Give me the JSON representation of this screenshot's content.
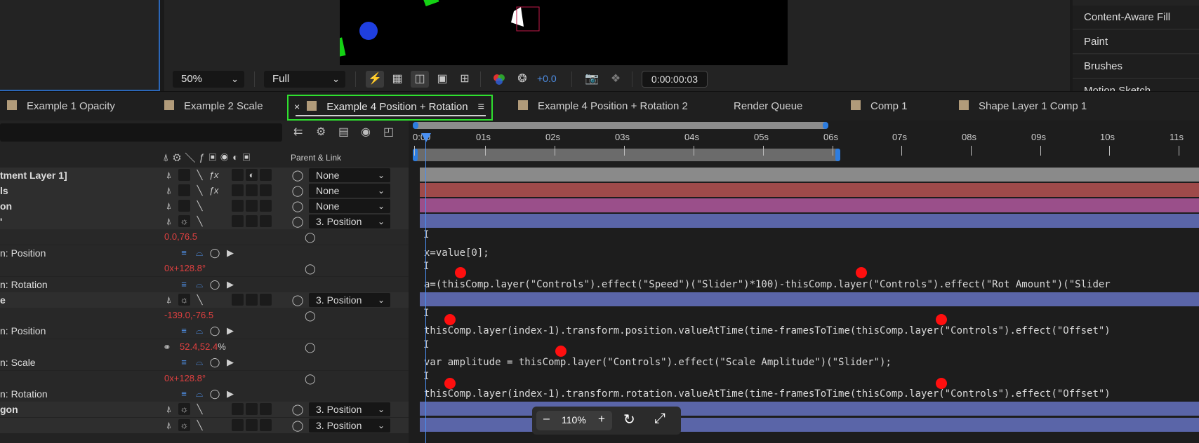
{
  "viewer": {
    "zoom": "50%",
    "resolution": "Full",
    "exposure": "+0.0",
    "timecode": "0:00:00:03"
  },
  "right_panel": {
    "items": [
      "Content-Aware Fill",
      "Paint",
      "Brushes",
      "Motion Sketch"
    ]
  },
  "tabs": [
    {
      "label": "Example 1 Opacity"
    },
    {
      "label": "Example 2 Scale"
    },
    {
      "label": "Example 4 Position + Rotation",
      "active": true
    },
    {
      "label": "Example 4 Position + Rotation 2"
    },
    {
      "label": "Render Queue"
    },
    {
      "label": "Comp 1"
    },
    {
      "label": "Shape Layer 1 Comp 1"
    }
  ],
  "close_glyph": "×",
  "header": {
    "parent_link": "Parent & Link"
  },
  "layers": [
    {
      "name": "tment Layer 1]",
      "parent": "None"
    },
    {
      "name": "ls",
      "parent": "None"
    },
    {
      "name": "on",
      "parent": "None"
    },
    {
      "name": "'",
      "parent": "3. Position"
    },
    {
      "value_red": "0.0,76.5"
    },
    {
      "name": "n: Position"
    },
    {
      "value_red_a": "0x",
      "value_red_b": "+128.8°"
    },
    {
      "name": "n: Rotation"
    },
    {
      "name": "e",
      "parent": "3. Position"
    },
    {
      "value_red": "-139.0,-76.5"
    },
    {
      "name": "n: Position"
    },
    {
      "value_red": "52.4,52.4",
      "unit": "%"
    },
    {
      "name": "n: Scale"
    },
    {
      "value_red_a": "0x",
      "value_red_b": "+128.8°"
    },
    {
      "name": "n: Rotation"
    },
    {
      "name": "gon",
      "parent": "3. Position"
    },
    {
      "name": "",
      "parent": "3. Position"
    }
  ],
  "timeline": {
    "ticks": [
      "0:00",
      "01s",
      "02s",
      "03s",
      "04s",
      "05s",
      "06s",
      "07s",
      "08s",
      "09s",
      "10s",
      "11s"
    ],
    "expressions": [
      "x=value[0];",
      "a=(thisComp.layer(\"Controls\").effect(\"Speed\")(\"Slider\")*100)-thisComp.layer(\"Controls\").effect(\"Rot Amount\")(\"Slider",
      "thisComp.layer(index-1).transform.position.valueAtTime(time-framesToTime(thisComp.layer(\"Controls\").effect(\"Offset\")",
      "var amplitude = thisComp.layer(\"Controls\").effect(\"Scale Amplitude\")(\"Slider\");",
      "thisComp.layer(index-1).transform.rotation.valueAtTime(time-framesToTime(thisComp.layer(\"Controls\").effect(\"Offset\")"
    ],
    "bar_colors": [
      "#8a8a8a",
      "#9e4a4a",
      "#9a4f8a",
      "#5a65a8"
    ]
  },
  "zoombar": {
    "minus": "–",
    "value": "110%",
    "plus": "+"
  }
}
